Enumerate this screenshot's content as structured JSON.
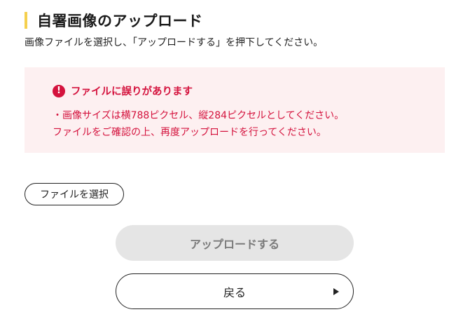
{
  "page": {
    "title": "自署画像のアップロード",
    "description": "画像ファイルを選択し、「アップロードする」を押下してください。"
  },
  "error": {
    "icon": "exclamation-icon",
    "title": "ファイルに誤りがあります",
    "lines": [
      "・画像サイズは横788ピクセル、縦284ピクセルとしてください。",
      "ファイルをご確認の上、再度アップロードを行ってください。"
    ],
    "color": "#d4123d",
    "background": "#fdf0f1"
  },
  "actions": {
    "file_select_label": "ファイルを選択",
    "upload_label": "アップロードする",
    "back_label": "戻る"
  },
  "colors": {
    "accent_bar": "#f5d04e",
    "disabled_button": "#e5e5e5"
  }
}
